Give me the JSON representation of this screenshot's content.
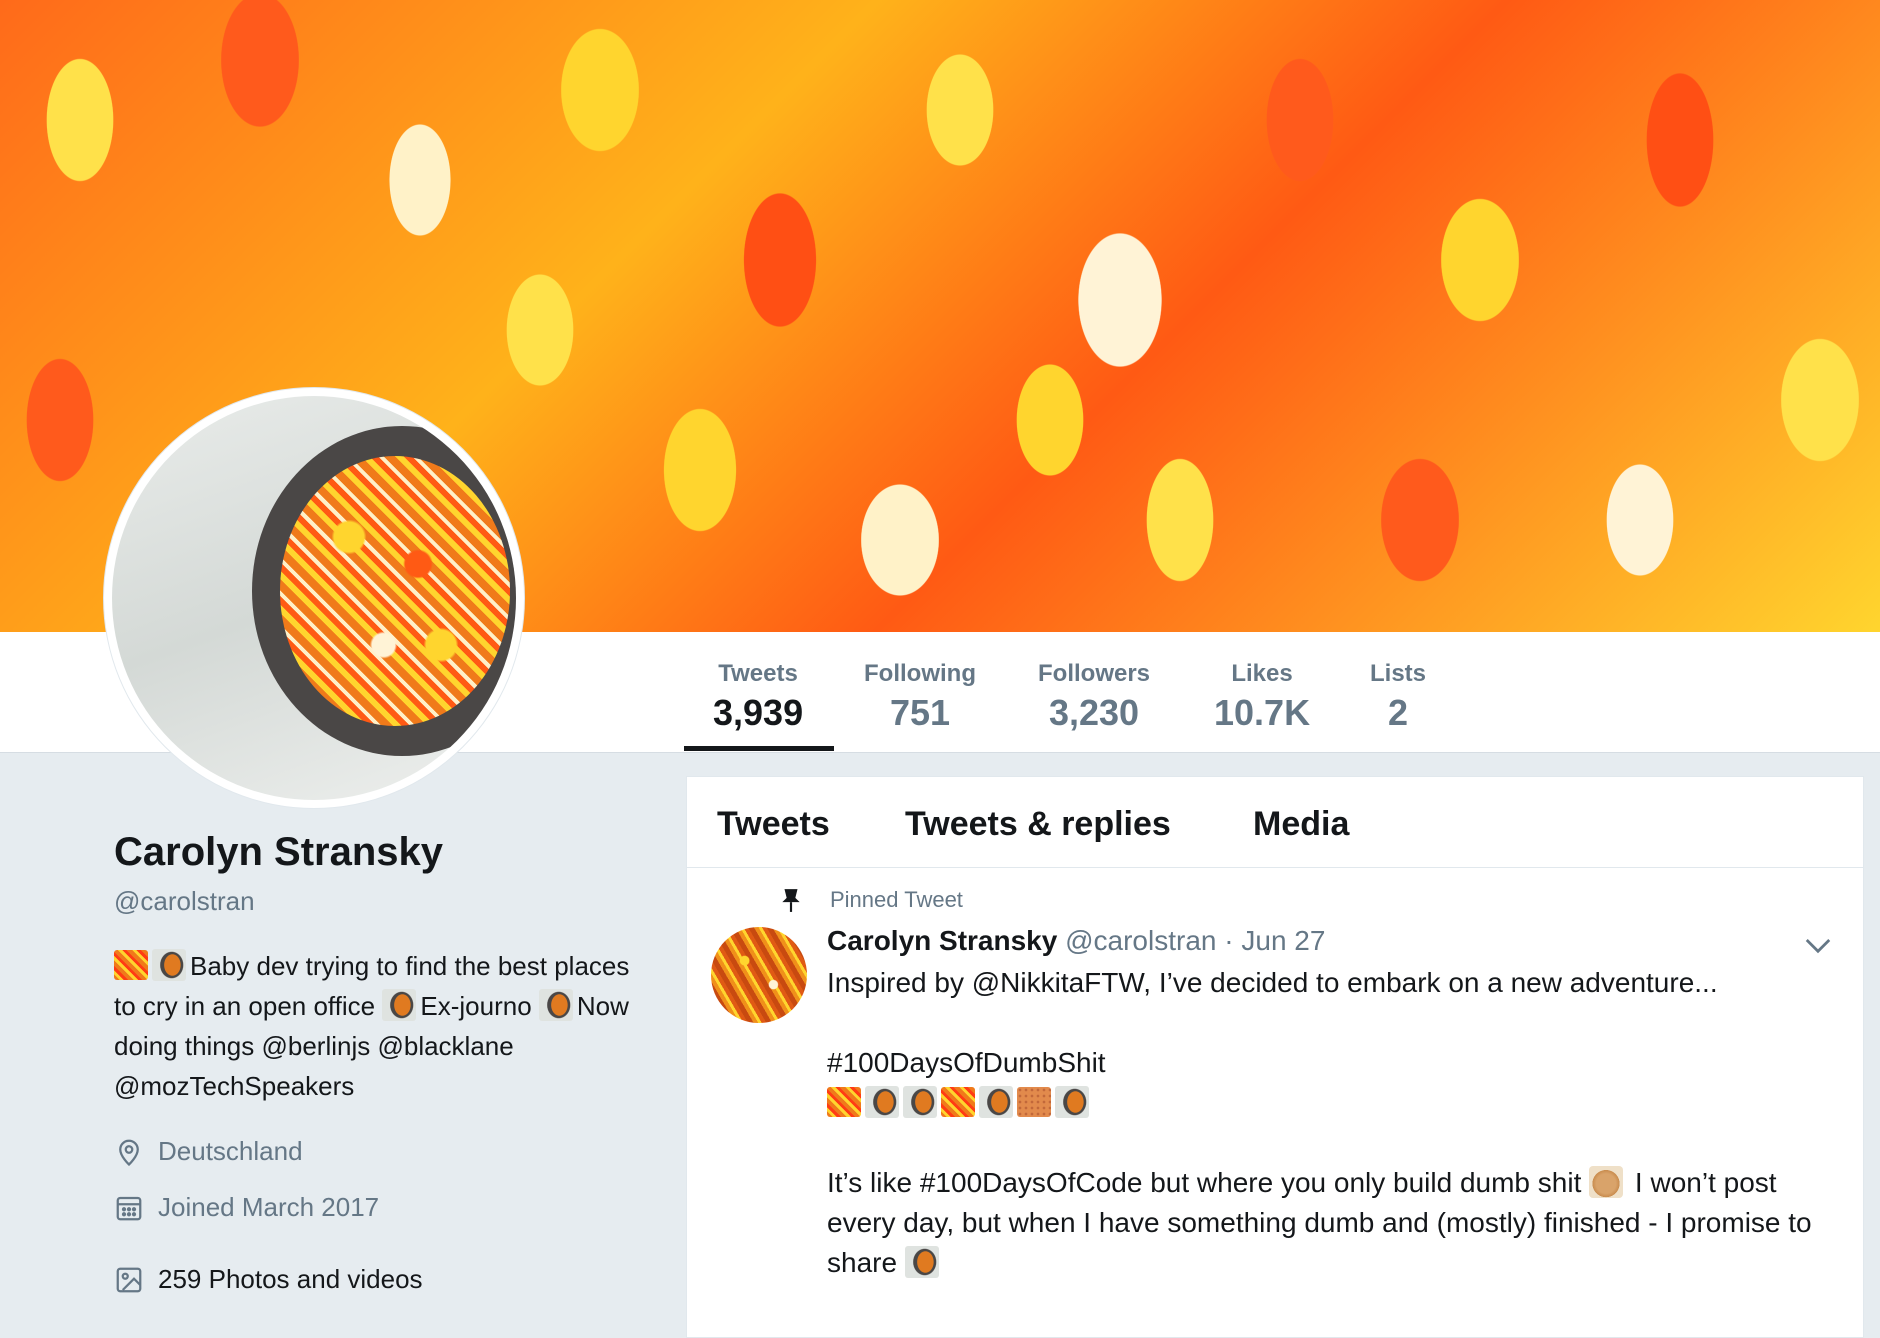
{
  "stats": [
    {
      "label": "Tweets",
      "value": "3,939"
    },
    {
      "label": "Following",
      "value": "751"
    },
    {
      "label": "Followers",
      "value": "3,230"
    },
    {
      "label": "Likes",
      "value": "10.7K"
    },
    {
      "label": "Lists",
      "value": "2"
    }
  ],
  "profile": {
    "name": "Carolyn Stransky",
    "handle": "@carolstran",
    "bio": {
      "part1": "Baby dev trying to find the best places to cry in an open office",
      "part2": "Ex-journo",
      "part3": "Now doing things",
      "mention1": "@berlinjs",
      "mention2": "@blacklane",
      "mention3": "@mozTechSpeakers"
    },
    "location": "Deutschland",
    "joined": "Joined March 2017",
    "photos": "259 Photos and videos"
  },
  "tabs": [
    "Tweets",
    "Tweets & replies",
    "Media"
  ],
  "pinned_label": "Pinned Tweet",
  "tweet": {
    "name": "Carolyn Stransky",
    "handle": "@carolstran",
    "date": "· Jun 27",
    "line1": "Inspired by @NikkitaFTW, I’ve decided to embark on a new adventure...",
    "hashtag": "#100DaysOfDumbShit",
    "line3a": "It’s like #100DaysOfCode but where you only build dumb shit",
    "line3b": "I won’t post every day, but when I have something dumb and (mostly) finished - I promise to share"
  },
  "icons": [
    "location-pin-icon",
    "calendar-icon",
    "photo-icon",
    "pin-icon",
    "chevron-down-icon"
  ]
}
